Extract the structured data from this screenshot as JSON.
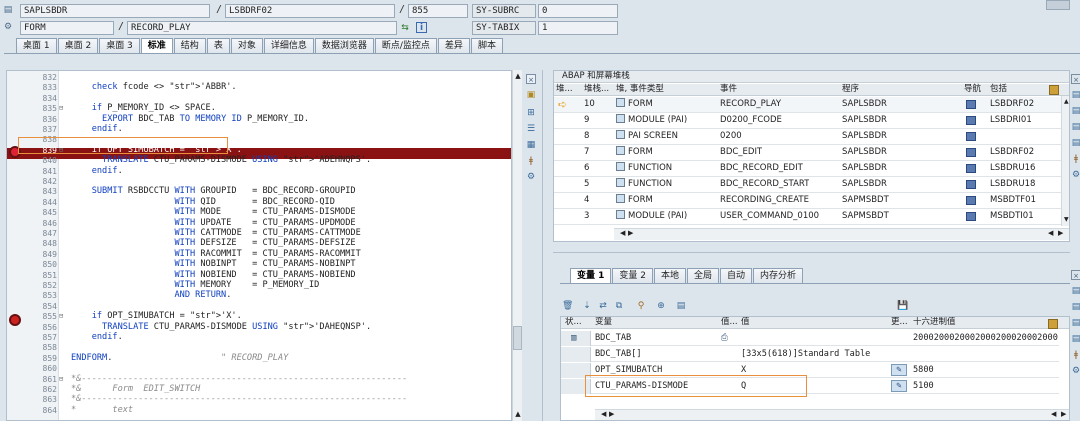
{
  "header": {
    "program": "SAPLSBDR",
    "include": "LSBDRF02",
    "line": "855",
    "sy_subrc_label": "SY-SUBRC",
    "sy_subrc_value": "0",
    "event_type": "FORM",
    "event_name": "RECORD_PLAY",
    "sy_tabix_label": "SY-TABIX",
    "sy_tabix_value": "1"
  },
  "tabs": [
    "桌面 1",
    "桌面 2",
    "桌面 3",
    "标准",
    "结构",
    "表",
    "对象",
    "详细信息",
    "数据浏览器",
    "断点/监控点",
    "差异",
    "脚本"
  ],
  "active_tab": "标准",
  "editor": {
    "lines": [
      {
        "n": "832",
        "text": ""
      },
      {
        "n": "833",
        "text": "    check fcode <> 'ABBR'."
      },
      {
        "n": "834",
        "text": ""
      },
      {
        "n": "835",
        "text": "    if P_MEMORY_ID <> SPACE."
      },
      {
        "n": "836",
        "text": "      EXPORT BDC_TAB TO MEMORY ID P_MEMORY_ID."
      },
      {
        "n": "837",
        "text": "    endif."
      },
      {
        "n": "838",
        "text": ""
      },
      {
        "n": "839",
        "text": "    if OPT_SIMUBATCH = 'X'."
      },
      {
        "n": "840",
        "text": "      TRANSLATE CTU_PARAMS-DISMODE USING 'ADEHNQPS'."
      },
      {
        "n": "841",
        "text": "    endif."
      },
      {
        "n": "842",
        "text": ""
      },
      {
        "n": "843",
        "text": "    SUBMIT RSBDCCTU WITH GROUPID   = BDC_RECORD-GROUPID"
      },
      {
        "n": "844",
        "text": "                    WITH QID       = BDC_RECORD-QID"
      },
      {
        "n": "845",
        "text": "                    WITH MODE      = CTU_PARAMS-DISMODE"
      },
      {
        "n": "846",
        "text": "                    WITH UPDATE    = CTU_PARAMS-UPDMODE"
      },
      {
        "n": "847",
        "text": "                    WITH CATTMODE  = CTU_PARAMS-CATTMODE"
      },
      {
        "n": "848",
        "text": "                    WITH DEFSIZE   = CTU_PARAMS-DEFSIZE"
      },
      {
        "n": "849",
        "text": "                    WITH RACOMMIT  = CTU_PARAMS-RACOMMIT"
      },
      {
        "n": "850",
        "text": "                    WITH NOBINPT   = CTU_PARAMS-NOBINPT"
      },
      {
        "n": "851",
        "text": "                    WITH NOBIEND   = CTU_PARAMS-NOBIEND"
      },
      {
        "n": "852",
        "text": "                    WITH MEMORY    = P_MEMORY_ID"
      },
      {
        "n": "853",
        "text": "                    AND RETURN."
      },
      {
        "n": "854",
        "text": ""
      },
      {
        "n": "855",
        "text": "    if OPT_SIMUBATCH = 'X'."
      },
      {
        "n": "856",
        "text": "      TRANSLATE CTU_PARAMS-DISMODE USING 'DAHEQNSP'."
      },
      {
        "n": "857",
        "text": "    endif."
      },
      {
        "n": "858",
        "text": ""
      },
      {
        "n": "859",
        "text": "ENDFORM.                     \" RECORD_PLAY"
      },
      {
        "n": "860",
        "text": ""
      },
      {
        "n": "861",
        "text": "*&---------------------------------------------------------------"
      },
      {
        "n": "862",
        "text": "*&      Form  EDIT_SWITCH"
      },
      {
        "n": "863",
        "text": "*&---------------------------------------------------------------"
      },
      {
        "n": "864",
        "text": "*       text"
      }
    ]
  },
  "stack": {
    "title": "ABAP 和屏幕堆栈",
    "columns": [
      "堆...",
      "堆栈...",
      "堆, 事件类型",
      "事件",
      "程序",
      "导航",
      "包括"
    ],
    "rows": [
      {
        "level": "10",
        "type": "FORM",
        "event": "RECORD_PLAY",
        "program": "SAPLSBDR",
        "include": "LSBDRF02",
        "current": true
      },
      {
        "level": "9",
        "type": "MODULE (PAI)",
        "event": "D0200_FCODE",
        "program": "SAPLSBDR",
        "include": "LSBDRI01",
        "current": false
      },
      {
        "level": "8",
        "type": "PAI SCREEN",
        "event": "0200",
        "program": "SAPLSBDR",
        "include": "",
        "current": false
      },
      {
        "level": "7",
        "type": "FORM",
        "event": "BDC_EDIT",
        "program": "SAPLSBDR",
        "include": "LSBDRF02",
        "current": false
      },
      {
        "level": "6",
        "type": "FUNCTION",
        "event": "BDC_RECORD_EDIT",
        "program": "SAPLSBDR",
        "include": "LSBDRU16",
        "current": false
      },
      {
        "level": "5",
        "type": "FUNCTION",
        "event": "BDC_RECORD_START",
        "program": "SAPLSBDR",
        "include": "LSBDRU18",
        "current": false
      },
      {
        "level": "4",
        "type": "FORM",
        "event": "RECORDING_CREATE",
        "program": "SAPMSBDT",
        "include": "MSBDTF01",
        "current": false
      },
      {
        "level": "3",
        "type": "MODULE (PAI)",
        "event": "USER_COMMAND_0100",
        "program": "SAPMSBDT",
        "include": "MSBDTI01",
        "current": false
      }
    ]
  },
  "var_tabs": [
    "变量 1",
    "变量 2",
    "本地",
    "全局",
    "自动",
    "内存分析"
  ],
  "variables": {
    "columns": [
      "状...",
      "变量",
      "值...",
      "值",
      "更...",
      "十六进制值"
    ],
    "rows": [
      {
        "name": "BDC_TAB",
        "value": "",
        "hex": "2000200020002000200020002000"
      },
      {
        "name": "BDC_TAB[]",
        "value": "[33x5(618)]Standard Table",
        "hex": ""
      },
      {
        "name": "OPT_SIMUBATCH",
        "value": "X",
        "hex": "5800"
      },
      {
        "name": "CTU_PARAMS-DISMODE",
        "value": "Q",
        "hex": "5100"
      }
    ]
  }
}
